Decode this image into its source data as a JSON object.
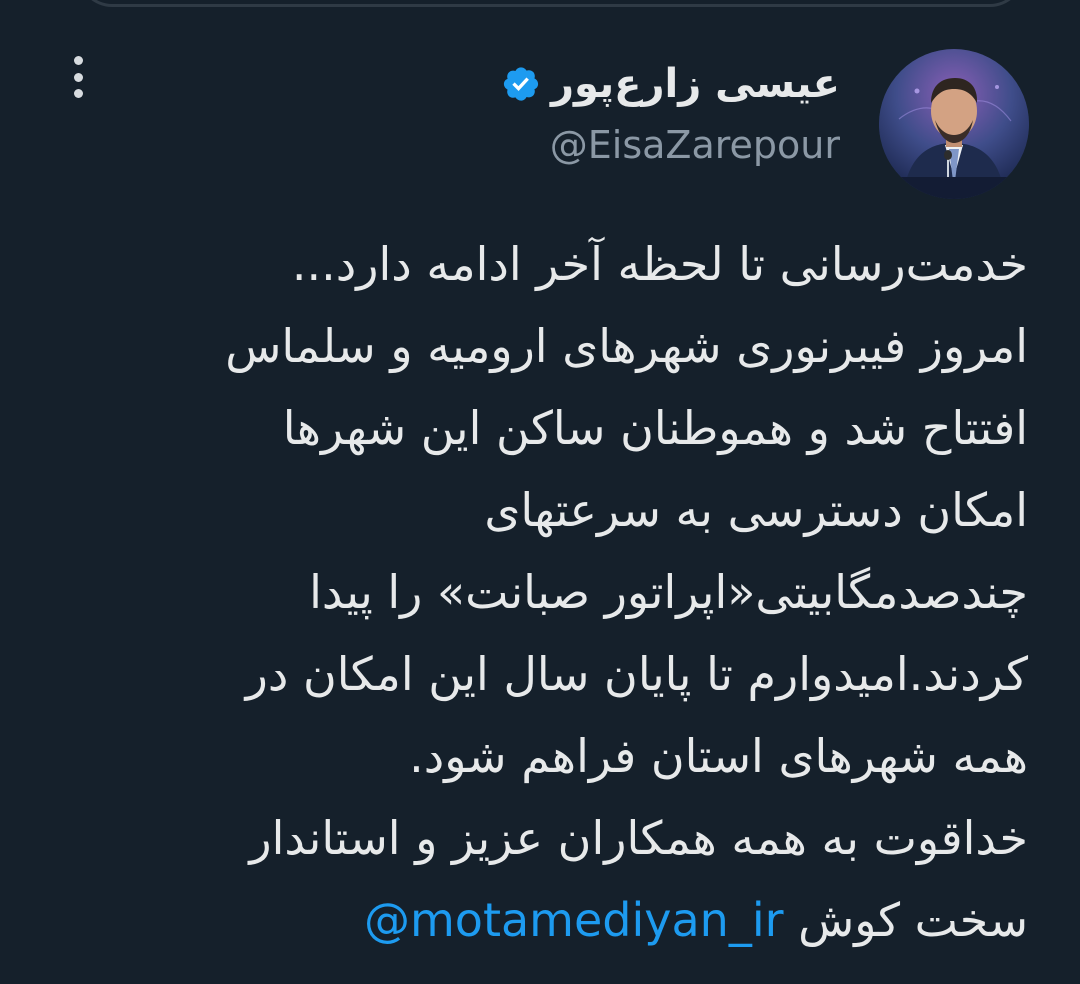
{
  "tweet": {
    "author": {
      "display_name": "عیسی زارع‌پور",
      "handle": "@EisaZarepour",
      "verified": true,
      "avatar_icon": "profile-photo"
    },
    "more_icon": "more-vertical-icon",
    "text_lines": [
      "خدمت‌رسانی تا لحظه آخر ادامه دارد...",
      "امروز فیبرنوری شهرهای ارومیه و سلماس",
      "افتتاح شد و هموطنان ساکن این شهرها",
      "امکان دسترسی به سرعتهای",
      "چندصدمگابیتی«اپراتور صبانت» را پیدا",
      "کردند.امیدوارم تا پایان سال این امکان در",
      "همه شهرهای استان فراهم شود.",
      "خداقوت به همه همکاران عزیز و استاندار"
    ],
    "last_line_text": "سخت کوش",
    "mention": "@motamediyan_ir"
  },
  "colors": {
    "background": "#15202b",
    "primary_text": "#e7e9ea",
    "secondary_text": "#8b98a5",
    "accent": "#1d9bf0"
  }
}
